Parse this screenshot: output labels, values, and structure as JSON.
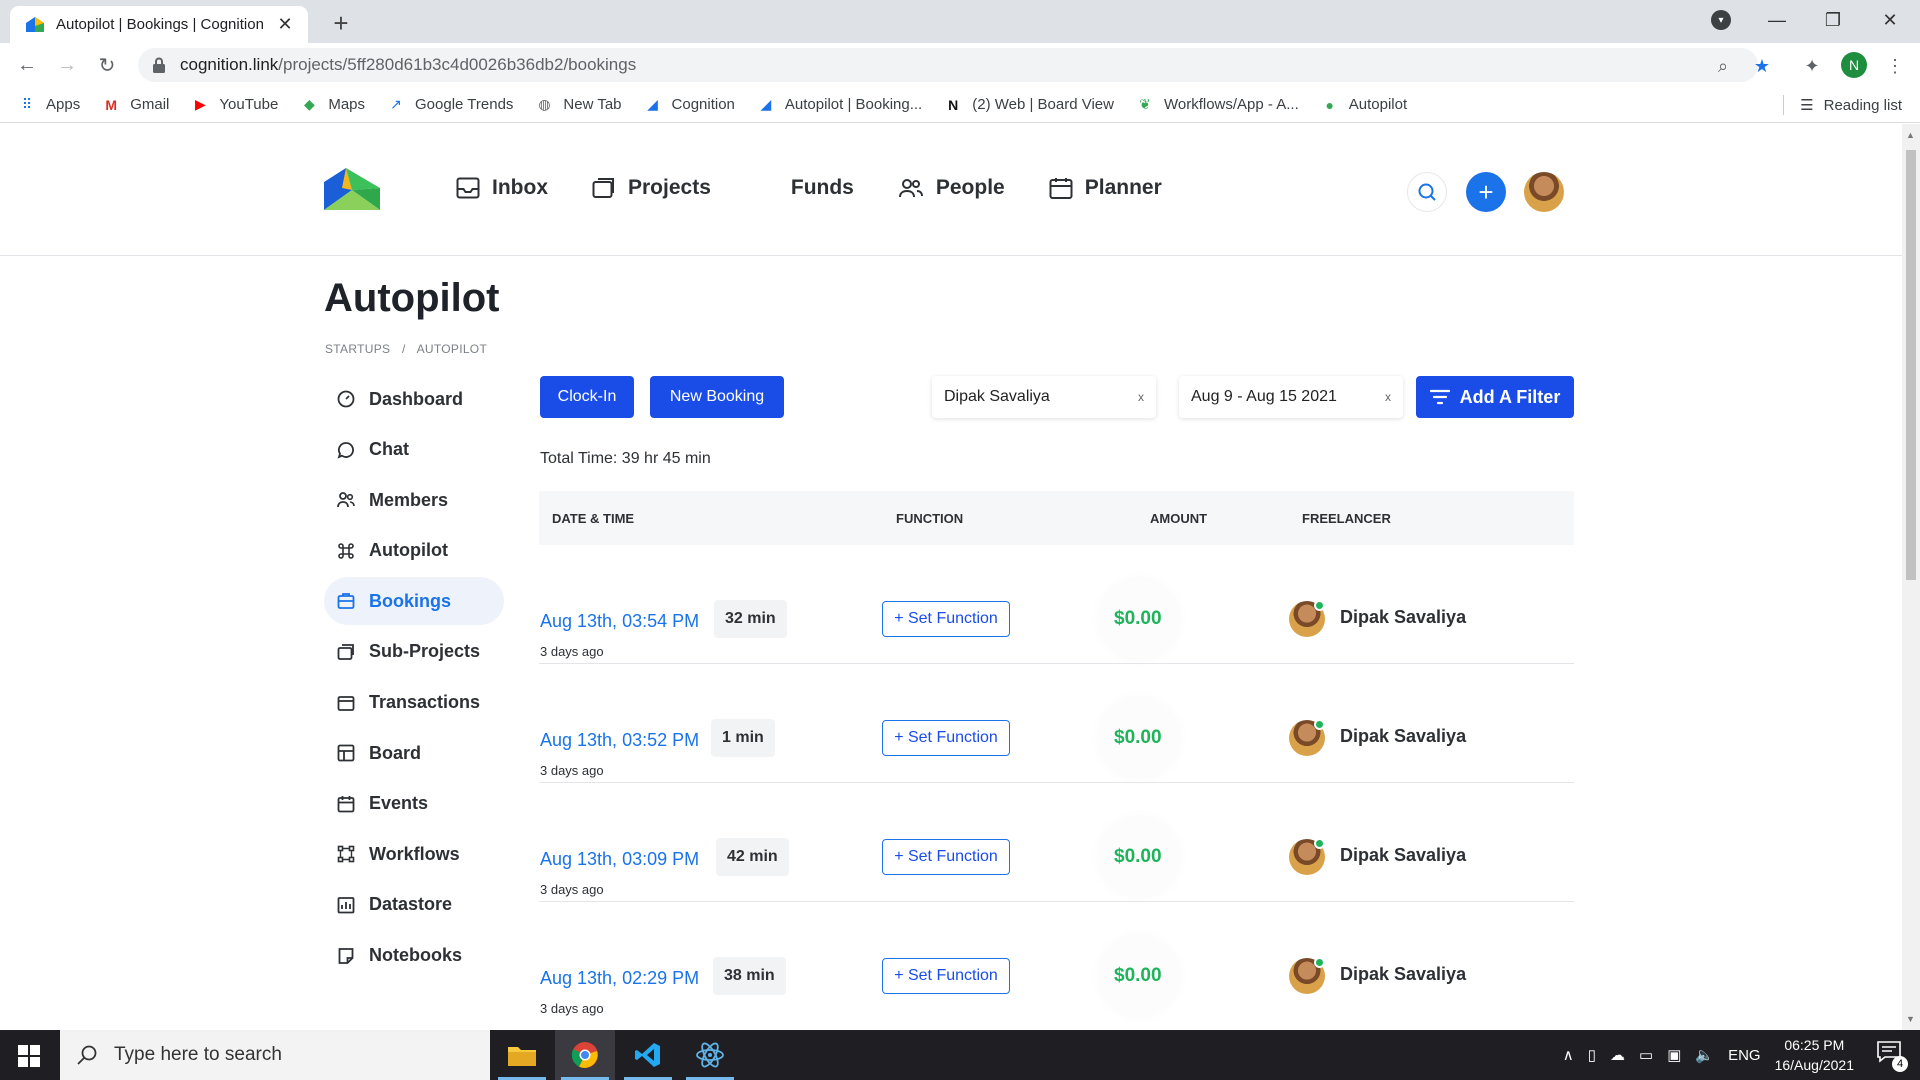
{
  "browser": {
    "tab_title": "Autopilot | Bookings | Cognition",
    "tab_close": "✕",
    "new_tab": "+",
    "url_host": "cognition.link",
    "url_path": "/projects/5ff280d61b3c4d0026b36db2/bookings",
    "profile_initial": "N",
    "bookmarks": [
      "Apps",
      "Gmail",
      "YouTube",
      "Maps",
      "Google Trends",
      "New Tab",
      "Cognition",
      "Autopilot | Booking...",
      "(2) Web | Board View",
      "Workflows/App - A...",
      "Autopilot"
    ],
    "reading_list": "Reading list"
  },
  "header": {
    "nav": [
      "Inbox",
      "Projects",
      "Funds",
      "People",
      "Planner"
    ],
    "add_label": "+"
  },
  "page": {
    "title": "Autopilot",
    "breadcrumbs": [
      "STARTUPS",
      "/",
      "AUTOPILOT"
    ]
  },
  "sidebar": {
    "items": [
      {
        "label": "Dashboard",
        "icon": "dashboard-icon"
      },
      {
        "label": "Chat",
        "icon": "chat-icon"
      },
      {
        "label": "Members",
        "icon": "members-icon"
      },
      {
        "label": "Autopilot",
        "icon": "command-icon"
      },
      {
        "label": "Bookings",
        "icon": "bookings-icon",
        "active": true
      },
      {
        "label": "Sub-Projects",
        "icon": "subprojects-icon"
      },
      {
        "label": "Transactions",
        "icon": "transactions-icon"
      },
      {
        "label": "Board",
        "icon": "board-icon"
      },
      {
        "label": "Events",
        "icon": "calendar-icon"
      },
      {
        "label": "Workflows",
        "icon": "workflow-icon"
      },
      {
        "label": "Datastore",
        "icon": "datastore-icon"
      },
      {
        "label": "Notebooks",
        "icon": "notebook-icon"
      }
    ]
  },
  "toolbar": {
    "clock_in": "Clock-In",
    "new_booking": "New Booking",
    "filter_person": "Dipak Savaliya",
    "filter_date": "Aug 9 - Aug 15 2021",
    "clear": "x",
    "add_filter": "Add A Filter"
  },
  "summary": {
    "total_time": "Total Time: 39 hr 45 min"
  },
  "table": {
    "columns": [
      "DATE & TIME",
      "FUNCTION",
      "AMOUNT",
      "FREELANCER"
    ],
    "rows": [
      {
        "datetime": "Aug 13th, 03:54 PM",
        "duration": "32 min",
        "ago": "3 days ago",
        "function": "+ Set Function",
        "amount": "$0.00",
        "freelancer": "Dipak Savaliya"
      },
      {
        "datetime": "Aug 13th, 03:52 PM",
        "duration": "1 min",
        "ago": "3 days ago",
        "function": "+ Set Function",
        "amount": "$0.00",
        "freelancer": "Dipak Savaliya"
      },
      {
        "datetime": "Aug 13th, 03:09 PM",
        "duration": "42 min",
        "ago": "3 days ago",
        "function": "+ Set Function",
        "amount": "$0.00",
        "freelancer": "Dipak Savaliya"
      },
      {
        "datetime": "Aug 13th, 02:29 PM",
        "duration": "38 min",
        "ago": "3 days ago",
        "function": "+ Set Function",
        "amount": "$0.00",
        "freelancer": "Dipak Savaliya"
      }
    ]
  },
  "taskbar": {
    "search_placeholder": "Type here to search",
    "lang": "ENG",
    "time": "06:25 PM",
    "date": "16/Aug/2021",
    "notifications": "4"
  },
  "colors": {
    "primary": "#1a4de8",
    "link": "#1a73e8",
    "amount": "#1fb35b"
  }
}
